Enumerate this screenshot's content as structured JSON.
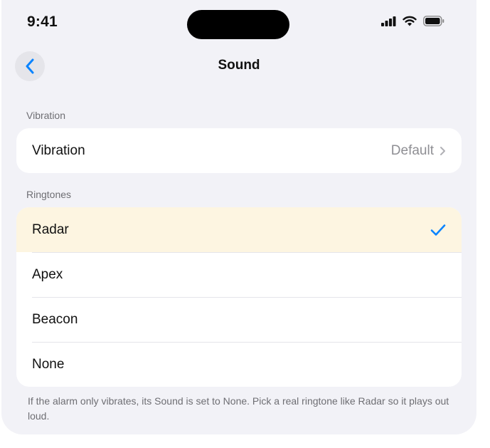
{
  "status_bar": {
    "time": "9:41",
    "icons": [
      "cellular-signal-icon",
      "wifi-icon",
      "battery-icon"
    ]
  },
  "nav": {
    "back_icon": "chevron-left-icon",
    "title": "Sound"
  },
  "vibration_section": {
    "header": "Vibration",
    "row": {
      "label": "Vibration",
      "value": "Default",
      "icon": "chevron-right-icon"
    }
  },
  "ringtones_section": {
    "header": "Ringtones",
    "items": [
      {
        "label": "Radar",
        "selected": true
      },
      {
        "label": "Apex",
        "selected": false
      },
      {
        "label": "Beacon",
        "selected": false
      },
      {
        "label": "None",
        "selected": false
      }
    ],
    "selected_icon": "checkmark-icon"
  },
  "footnote": "If the alarm only vibrates, its Sound is set to None. Pick a real ringtone like Radar so it plays out loud.",
  "colors": {
    "accent": "#0a84ff",
    "background": "#f2f2f7",
    "selected_row": "#fdf5e1",
    "secondary_text": "#8e8e93"
  }
}
